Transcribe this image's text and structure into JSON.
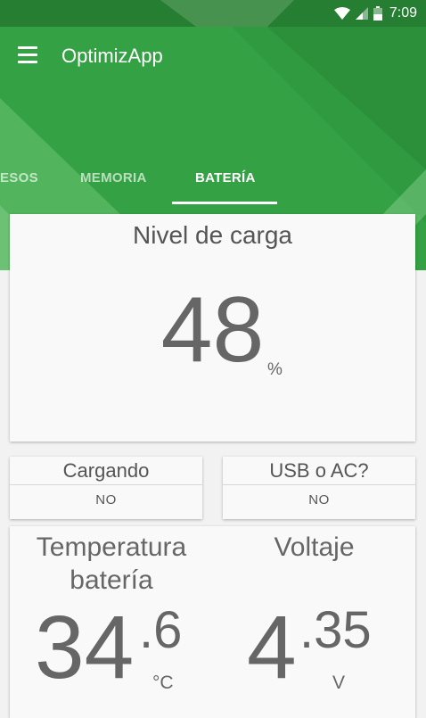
{
  "status_bar": {
    "time": "7:09",
    "icons": [
      "wifi-icon",
      "signal-icon",
      "battery-icon"
    ]
  },
  "app": {
    "title": "OptimizApp",
    "menu_icon": "hamburger-menu-icon"
  },
  "tabs": [
    {
      "label": "ESOS",
      "selected": false
    },
    {
      "label": "MEMORIA",
      "selected": false
    },
    {
      "label": "BATERÍA",
      "selected": true
    }
  ],
  "charge": {
    "title": "Nivel de carga",
    "value": "48",
    "unit": "%"
  },
  "charging": {
    "title": "Cargando",
    "value": "NO"
  },
  "source": {
    "title": "USB o AC?",
    "value": "NO"
  },
  "temperature": {
    "title_line1": "Temperatura",
    "title_line2": "batería",
    "integer": "34",
    "decimal": ".6",
    "unit": "°C"
  },
  "voltage": {
    "title": "Voltaje",
    "integer": "4",
    "decimal": ".35",
    "unit": "V"
  },
  "colors": {
    "header_green": "#2f9a3f",
    "card_bg": "#f9f9f9",
    "page_bg": "#f2f2f2"
  }
}
